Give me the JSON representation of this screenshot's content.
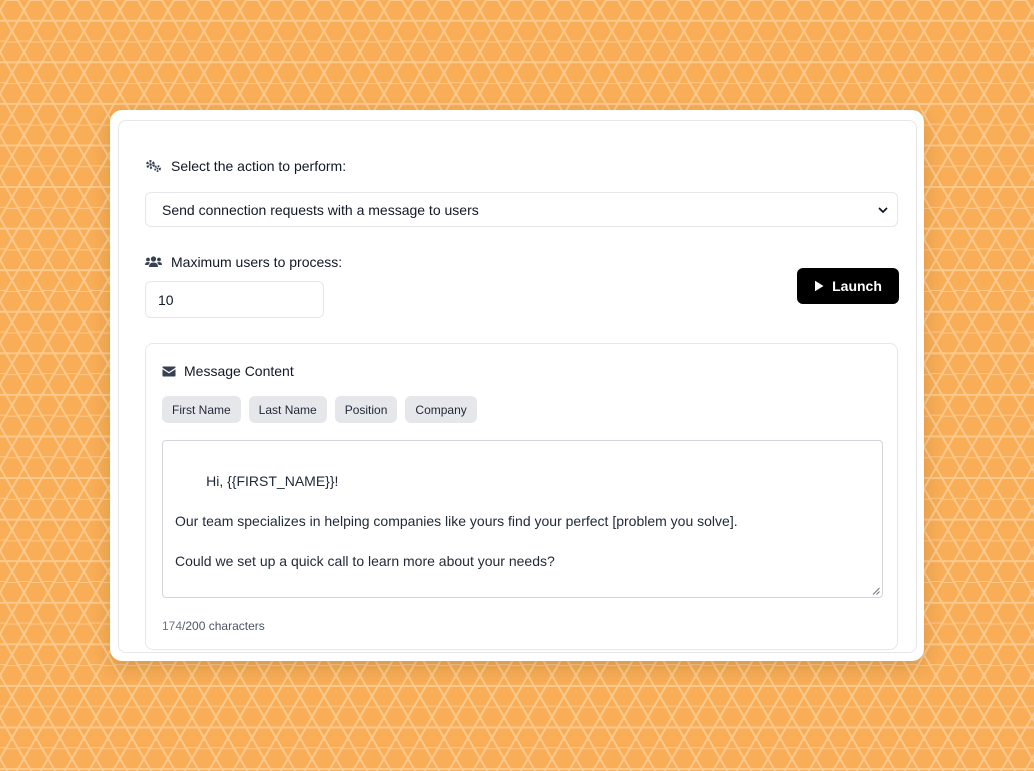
{
  "action": {
    "label": "Select the action to perform:",
    "selected": "Send connection requests with a message to users",
    "icon": "gears-icon"
  },
  "max_users": {
    "label": "Maximum users to process:",
    "value": "10",
    "icon": "users-icon"
  },
  "launch_button": {
    "label": "Launch",
    "icon": "play-icon"
  },
  "message": {
    "title": "Message Content",
    "icon": "envelope-icon",
    "chips": [
      "First Name",
      "Last Name",
      "Position",
      "Company"
    ],
    "text": "Hi, {{FIRST_NAME}}!\n\nOur team specializes in helping companies like yours find your perfect [problem you solve].\n\nCould we set up a quick call to learn more about your needs?",
    "char_count": "174",
    "char_limit_text": "/200 characters"
  },
  "colors": {
    "background": "#f8ad56",
    "hex_lines": "#fbc98c",
    "button": "#000000",
    "chip": "#e5e7eb"
  }
}
